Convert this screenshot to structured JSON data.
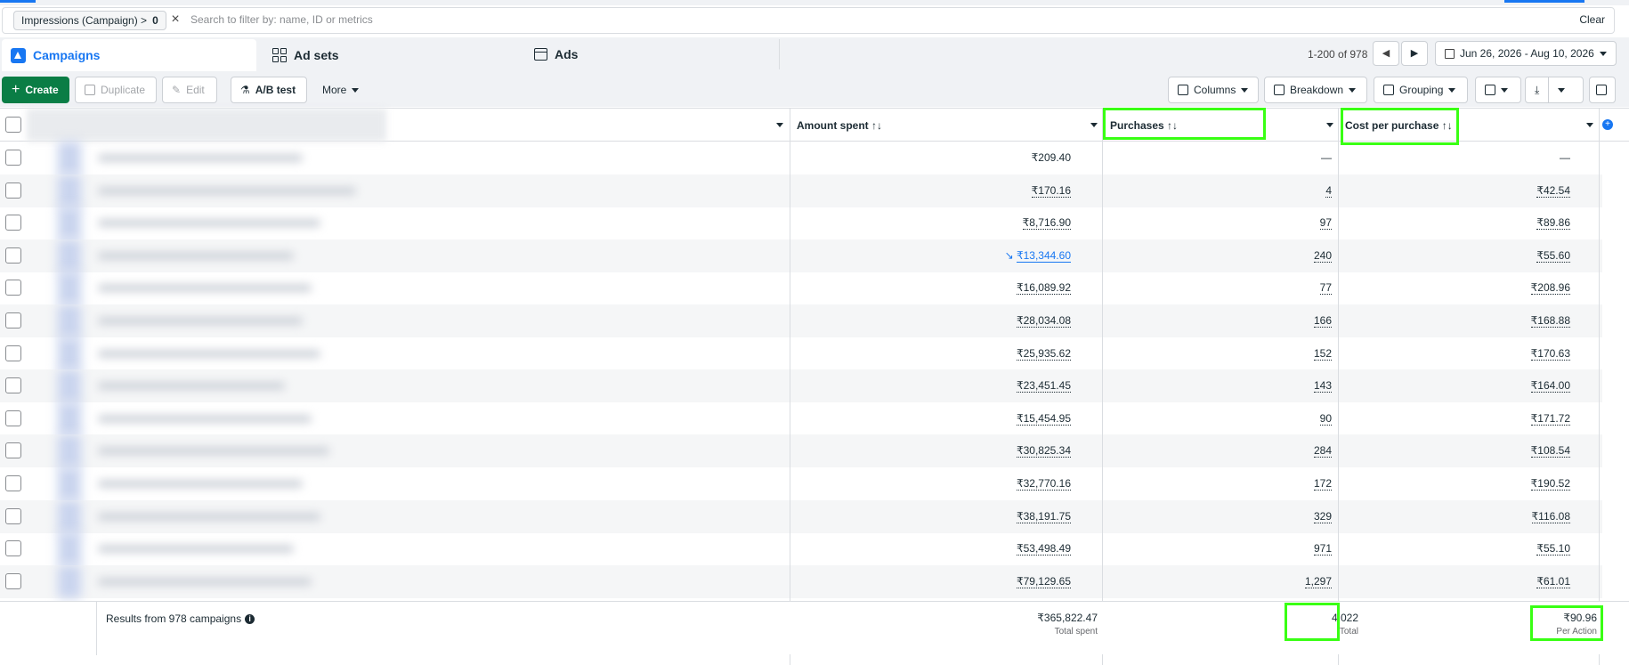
{
  "filter": {
    "chip_label": "Impressions (Campaign) >",
    "chip_value": "0",
    "search_placeholder": "Search to filter by: name, ID or metrics",
    "clear_label": "Clear"
  },
  "tabs": [
    {
      "label": "Campaigns",
      "active": true
    },
    {
      "label": "Ad sets",
      "active": false
    },
    {
      "label": "Ads",
      "active": false
    }
  ],
  "pagination": {
    "range": "1-200 of 978",
    "prev": "◀",
    "next": "▶"
  },
  "date_range": "Jun 26, 2026 - Aug 10, 2026",
  "toolbar": {
    "create": "Create",
    "duplicate": "Duplicate",
    "edit": "Edit",
    "ab_test": "A/B test",
    "more": "More",
    "columns": "Columns",
    "breakdown": "Breakdown",
    "grouping": "Grouping"
  },
  "columns": {
    "amount_spent": "Amount spent ↑↓",
    "purchases": "Purchases ↑↓",
    "cost_per_purchase": "Cost per purchase ↑↓"
  },
  "rows": [
    {
      "amount": "₹209.40",
      "purchases": "—",
      "cpp": "—"
    },
    {
      "amount": "₹170.16",
      "purchases": "4",
      "cpp": "₹42.54"
    },
    {
      "amount": "₹8,716.90",
      "purchases": "97",
      "cpp": "₹89.86"
    },
    {
      "amount": "₹13,344.60",
      "purchases": "240",
      "cpp": "₹55.60"
    },
    {
      "amount": "₹16,089.92",
      "purchases": "77",
      "cpp": "₹208.96"
    },
    {
      "amount": "₹28,034.08",
      "purchases": "166",
      "cpp": "₹168.88"
    },
    {
      "amount": "₹25,935.62",
      "purchases": "152",
      "cpp": "₹170.63"
    },
    {
      "amount": "₹23,451.45",
      "purchases": "143",
      "cpp": "₹164.00"
    },
    {
      "amount": "₹15,454.95",
      "purchases": "90",
      "cpp": "₹171.72"
    },
    {
      "amount": "₹30,825.34",
      "purchases": "284",
      "cpp": "₹108.54"
    },
    {
      "amount": "₹32,770.16",
      "purchases": "172",
      "cpp": "₹190.52"
    },
    {
      "amount": "₹38,191.75",
      "purchases": "329",
      "cpp": "₹116.08"
    },
    {
      "amount": "₹53,498.49",
      "purchases": "971",
      "cpp": "₹55.10"
    },
    {
      "amount": "₹79,129.65",
      "purchases": "1,297",
      "cpp": "₹61.01"
    }
  ],
  "totals": {
    "label": "Results from 978 campaigns",
    "amount": "₹365,822.47",
    "amount_sub": "Total spent",
    "purchases": "4,022",
    "purchases_sub": "Total",
    "cpp": "₹90.96",
    "cpp_sub": "Per Action"
  },
  "colors": {
    "accent": "#1877f2",
    "create_green": "#0a7d45",
    "highlight": "#39ff14"
  }
}
